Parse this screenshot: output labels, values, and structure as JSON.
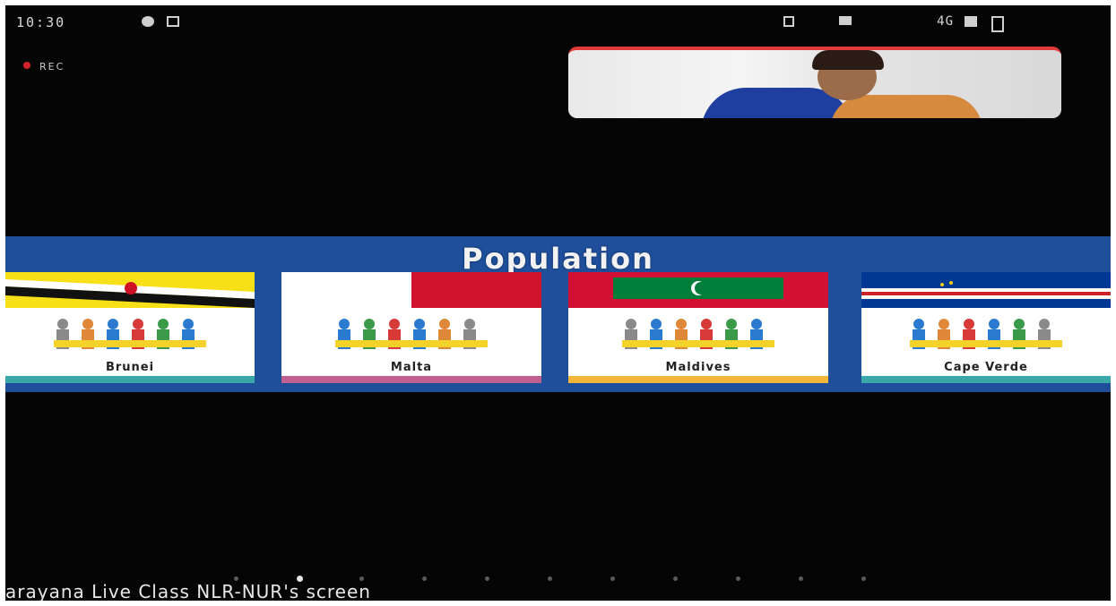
{
  "status_bar": {
    "time": "10:30",
    "right_text": "4G"
  },
  "recording": {
    "label": "REC"
  },
  "slide": {
    "title": "Population",
    "cards": [
      {
        "country_label": "Brunei"
      },
      {
        "country_label": "Malta"
      },
      {
        "country_label": "Maldives"
      },
      {
        "country_label": "Cape Verde"
      }
    ]
  },
  "pager": {
    "page_count": 11,
    "active_index": 1
  },
  "share_caption": "arayana Live Class NLR-NUR's screen",
  "colors": {
    "slide_blue": "#1f4f9a",
    "rec_red": "#d2232a"
  }
}
